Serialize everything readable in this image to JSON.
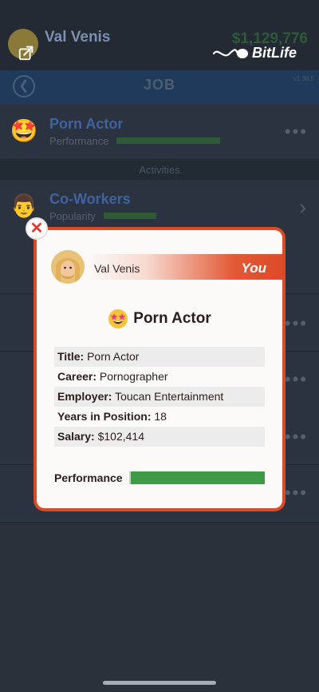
{
  "header": {
    "character_name": "Val Venis",
    "money": "$1,129,776",
    "brand": "BitLife",
    "version": "v1.38.5"
  },
  "nav": {
    "title": "JOB"
  },
  "job_row": {
    "title": "Porn Actor",
    "subtitle": "Performance",
    "emoji": "🤩"
  },
  "activities_label": "Activities",
  "activity_rows": [
    {
      "title": "Co-Workers",
      "subtitle": "Popularity",
      "emoji": "👨"
    }
  ],
  "modal": {
    "character_name": "Val Venis",
    "badge": "You",
    "job_title": "Porn Actor",
    "job_emoji": "🤩",
    "details": [
      {
        "label": "Title:",
        "value": "Porn Actor"
      },
      {
        "label": "Career:",
        "value": "Pornographer"
      },
      {
        "label": "Employer:",
        "value": "Toucan Entertainment"
      },
      {
        "label": "Years in Position:",
        "value": "18"
      },
      {
        "label": "Salary:",
        "value": "$102,414"
      }
    ],
    "performance_label": "Performance",
    "performance_level": 1.0,
    "close_icon": "close-icon"
  },
  "colors": {
    "accent_red": "#dd4a27",
    "bar_green": "#3f9a48",
    "you_white": "#ffffff"
  }
}
